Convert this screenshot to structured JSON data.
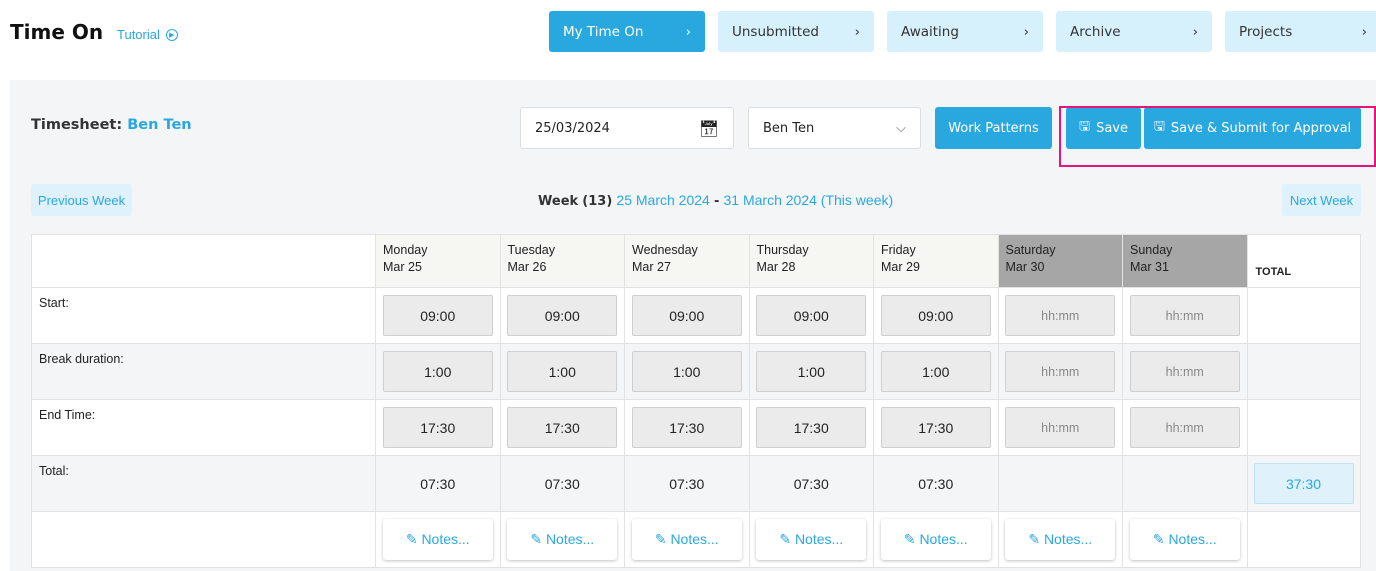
{
  "header": {
    "title": "Time On",
    "tutorial": "Tutorial"
  },
  "tabs": [
    {
      "label": "My Time On"
    },
    {
      "label": "Unsubmitted"
    },
    {
      "label": "Awaiting"
    },
    {
      "label": "Archive"
    },
    {
      "label": "Projects"
    }
  ],
  "timesheet": {
    "label": "Timesheet:",
    "name": "Ben Ten"
  },
  "toolbar": {
    "date": "25/03/2024",
    "user": "Ben Ten",
    "work_patterns": "Work Patterns",
    "save": "Save",
    "save_submit": "Save & Submit for Approval"
  },
  "week": {
    "prev": "Previous Week",
    "next": "Next Week",
    "label": "Week",
    "num": "(13)",
    "start": "25 March 2024",
    "sep": "-",
    "end": "31 March 2024 (This week)"
  },
  "table": {
    "total_header": "TOTAL",
    "days": [
      {
        "name": "Monday",
        "date": "Mar 25",
        "start": "09:00",
        "break": "1:00",
        "end": "17:30",
        "total": "07:30"
      },
      {
        "name": "Tuesday",
        "date": "Mar 26",
        "start": "09:00",
        "break": "1:00",
        "end": "17:30",
        "total": "07:30"
      },
      {
        "name": "Wednesday",
        "date": "Mar 27",
        "start": "09:00",
        "break": "1:00",
        "end": "17:30",
        "total": "07:30"
      },
      {
        "name": "Thursday",
        "date": "Mar 28",
        "start": "09:00",
        "break": "1:00",
        "end": "17:30",
        "total": "07:30"
      },
      {
        "name": "Friday",
        "date": "Mar 29",
        "start": "09:00",
        "break": "1:00",
        "end": "17:30",
        "total": "07:30"
      },
      {
        "name": "Saturday",
        "date": "Mar 30",
        "start": "hh:mm",
        "break": "hh:mm",
        "end": "hh:mm",
        "total": ""
      },
      {
        "name": "Sunday",
        "date": "Mar 31",
        "start": "hh:mm",
        "break": "hh:mm",
        "end": "hh:mm",
        "total": ""
      }
    ],
    "rows": {
      "start": "Start:",
      "break": "Break duration:",
      "end": "End Time:",
      "total": "Total:"
    },
    "notes_label": "Notes...",
    "week_total": "37:30"
  }
}
